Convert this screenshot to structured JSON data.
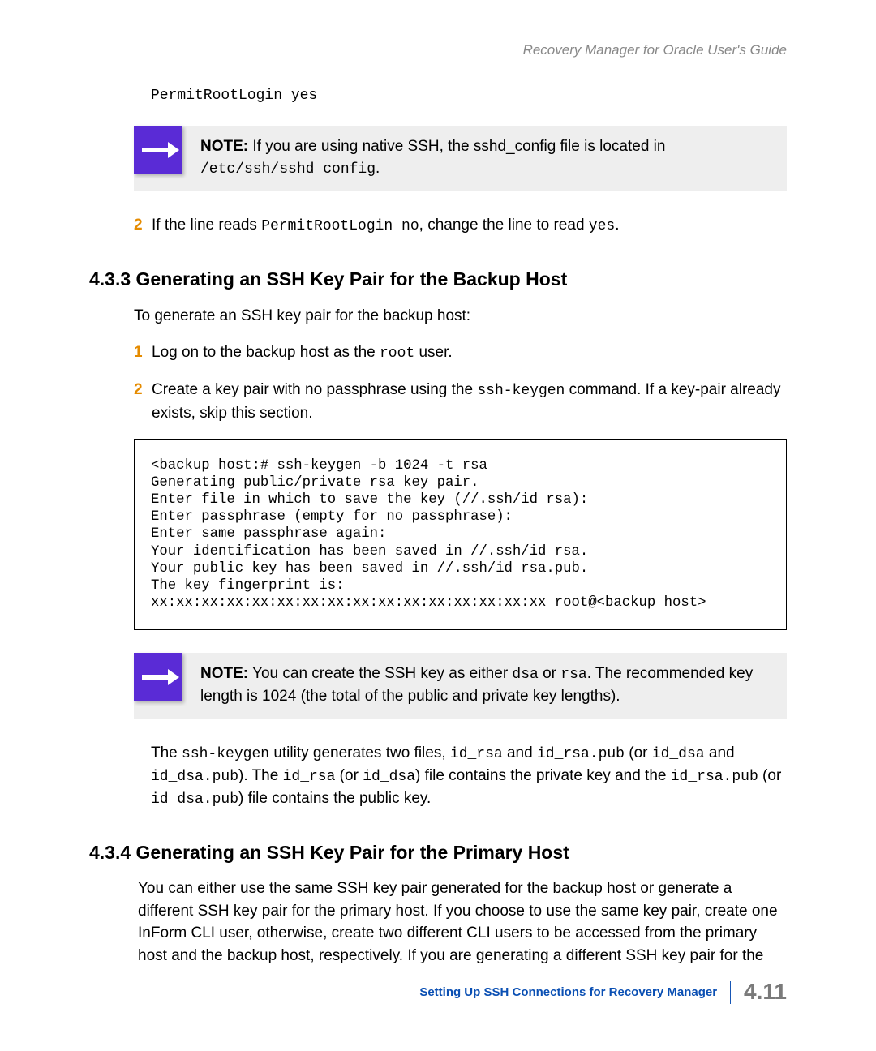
{
  "header": {
    "doc_title": "Recovery Manager for Oracle User's Guide"
  },
  "top": {
    "permit_line": "PermitRootLogin yes",
    "note1_bold": "NOTE:",
    "note1_text_a": " If you are using native SSH, the sshd_config file is located in ",
    "note1_code": "/etc/ssh/sshd_config",
    "note1_text_b": ".",
    "step2_a": "If the line reads ",
    "step2_code1": "PermitRootLogin no",
    "step2_b": ", change the line to read ",
    "step2_code2": "yes",
    "step2_c": "."
  },
  "s433": {
    "heading": "4.3.3 Generating an SSH Key Pair for the Backup Host",
    "intro": "To generate an SSH key pair for the backup host:",
    "step1_a": "Log on to the backup host as the ",
    "step1_code": "root",
    "step1_b": " user.",
    "step2_a": "Create a key pair with no passphrase using the ",
    "step2_code": "ssh-keygen",
    "step2_b": " command. If a key-pair already exists, skip this section.",
    "codeblock": "<backup_host:# ssh-keygen -b 1024 -t rsa\nGenerating public/private rsa key pair.\nEnter file in which to save the key (//.ssh/id_rsa):\nEnter passphrase (empty for no passphrase):\nEnter same passphrase again:\nYour identification has been saved in //.ssh/id_rsa.\nYour public key has been saved in //.ssh/id_rsa.pub.\nThe key fingerprint is:\nxx:xx:xx:xx:xx:xx:xx:xx:xx:xx:xx:xx:xx:xx:xx:xx root@<backup_host>",
    "note2_bold": "NOTE:",
    "note2_a": "  You can create the SSH key as either ",
    "note2_c1": "dsa",
    "note2_b": " or ",
    "note2_c2": "rsa",
    "note2_c": ". The recommended key length is 1024 (the total of the public and private key lengths).",
    "para2_a": "The ",
    "para2_c1": "ssh-keygen",
    "para2_b": " utility generates two files, ",
    "para2_c2": "id_rsa",
    "para2_c": " and ",
    "para2_c3": "id_rsa.pub",
    "para2_d": " (or ",
    "para2_c4": "id_dsa",
    "para2_e": " and ",
    "para2_c5": "id_dsa.pub",
    "para2_f": "). The  ",
    "para2_c6": "id_rsa",
    "para2_g": " (or ",
    "para2_c7": "id_dsa",
    "para2_h": ") file contains the private key and the ",
    "para2_c8": "id_rsa.pub",
    "para2_i": " (or ",
    "para2_c9": "id_dsa.pub",
    "para2_j": ") file contains the public key."
  },
  "s434": {
    "heading": "4.3.4 Generating an SSH Key Pair for the Primary Host",
    "para": "You can either use the same SSH key pair generated for the backup host or generate a different SSH key pair for the primary host. If you choose to use the same key pair, create one InForm CLI user, otherwise, create two different CLI users to be accessed from the primary host and the backup host, respectively. If you are generating a different SSH key pair for the"
  },
  "footer": {
    "section": "Setting Up SSH Connections for Recovery Manager",
    "page": "4.11"
  },
  "nums": {
    "two": "2",
    "one": "1"
  }
}
